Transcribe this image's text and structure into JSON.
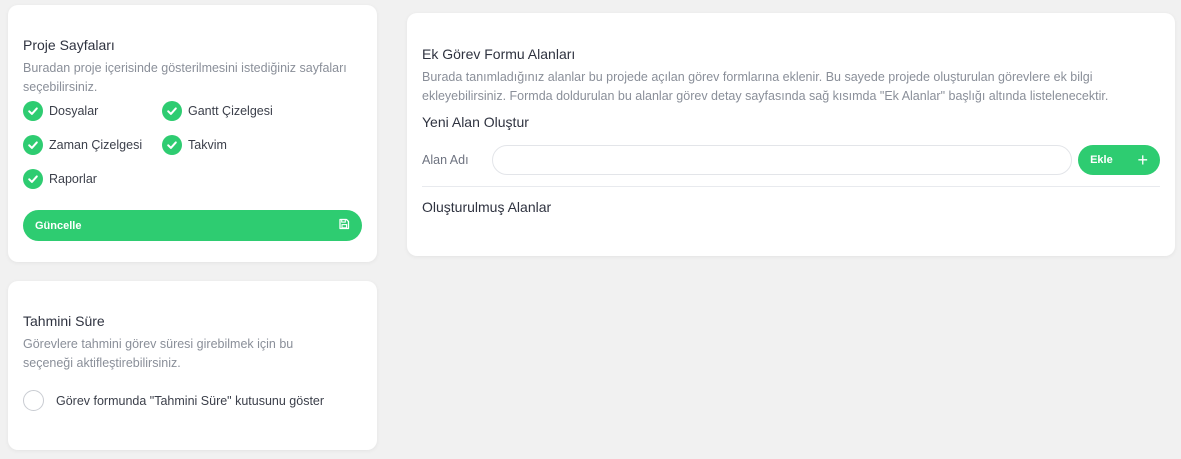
{
  "pages_card": {
    "title": "Proje Sayfaları",
    "description": "Buradan proje içerisinde gösterilmesini istediğiniz sayfaları seçebilirsiniz.",
    "items": [
      {
        "label": "Dosyalar",
        "checked": true
      },
      {
        "label": "Gantt Çizelgesi",
        "checked": true
      },
      {
        "label": "Zaman Çizelgesi",
        "checked": true
      },
      {
        "label": "Takvim",
        "checked": true
      },
      {
        "label": "Raporlar",
        "checked": true
      }
    ],
    "update_label": "Güncelle",
    "update_icon": "save-icon"
  },
  "estimate_card": {
    "title": "Tahmini Süre",
    "description": "Görevlere tahmini görev süresi girebilmek için bu seçeneği aktifleştirebilirsiniz.",
    "option_label": "Görev formunda \"Tahmini Süre\" kutusunu göster",
    "option_checked": false
  },
  "extra_card": {
    "title": "Ek Görev Formu Alanları",
    "description": "Burada tanımladığınız alanlar bu projede açılan görev formlarına eklenir. Bu sayede projede oluşturulan görevlere ek bilgi ekleyebilirsiniz. Formda doldurulan bu alanlar görev detay sayfasında sağ kısımda \"Ek Alanlar\" başlığı altında listelenecektir.",
    "new_field_title": "Yeni Alan Oluştur",
    "field_name_label": "Alan Adı",
    "field_name_value": "",
    "field_name_placeholder": "",
    "add_label": "Ekle",
    "add_icon": "plus-icon",
    "created_title": "Oluşturulmuş Alanlar"
  },
  "colors": {
    "accent": "#2ecc71",
    "background": "#f1f1f1",
    "card": "#ffffff",
    "muted_text": "#8a8f99"
  }
}
